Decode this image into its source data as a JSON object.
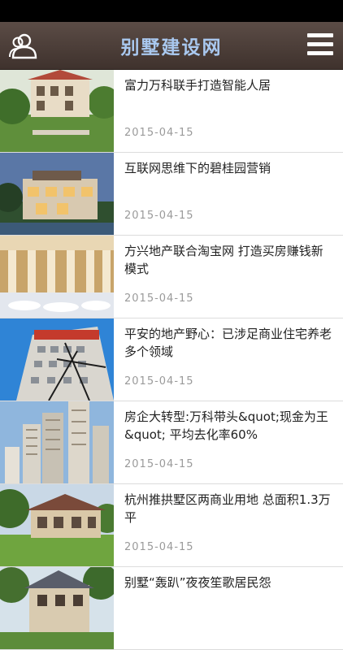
{
  "header": {
    "title": "别墅建设网",
    "left_icon": "user-icon",
    "right_icon": "menu-icon",
    "background": "#4a3c36",
    "title_color": "#a9c8ef"
  },
  "news": [
    {
      "title": "富力万科联手打造智能人居",
      "date": "2015-04-15",
      "image": "villa-garden-image"
    },
    {
      "title": "互联网思维下的碧桂园营销",
      "date": "2015-04-15",
      "image": "villa-dusk-image"
    },
    {
      "title": "方兴地产联合淘宝网 打造买房赚钱新模式",
      "date": "2015-04-15",
      "image": "sales-hall-image"
    },
    {
      "title": "平安的地产野心：已涉足商业住宅养老多个领域",
      "date": "2015-04-15",
      "image": "tower-construction-image"
    },
    {
      "title": "房企大转型:万科带头&quot;现金为王&quot; 平均去化率60%",
      "date": "2015-04-15",
      "image": "high-rise-image"
    },
    {
      "title": "杭州推拱墅区两商业用地 总面积1.3万平",
      "date": "2015-04-15",
      "image": "villa-lawn-image"
    },
    {
      "title": "别墅“轰趴”夜夜笙歌居民怨",
      "date": "",
      "image": "villa-trees-image"
    }
  ]
}
